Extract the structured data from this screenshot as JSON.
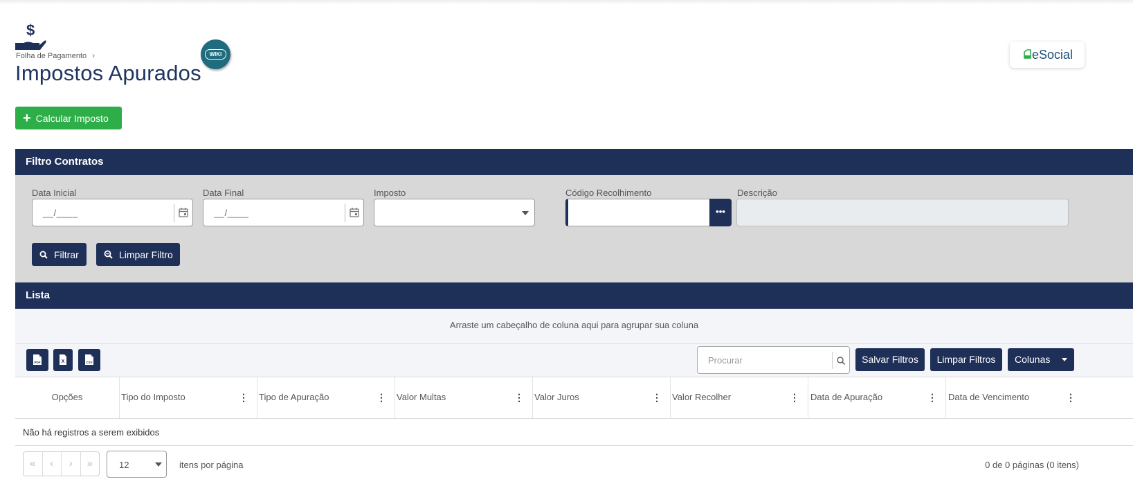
{
  "header": {
    "breadcrumb": "Folha de Pagamento",
    "breadcrumb_sep": "›",
    "title": "Impostos Apurados",
    "wiki_label": "WIKI",
    "esocial_label": "eSocial",
    "page_icon": "money-hand-icon"
  },
  "actions": {
    "calc_label": "Calcular Imposto"
  },
  "filter": {
    "title": "Filtro Contratos",
    "data_inicial_label": "Data Inicial",
    "data_inicial_mask": "__/____",
    "data_final_label": "Data Final",
    "data_final_mask": "__/____",
    "imposto_label": "Imposto",
    "imposto_value": "",
    "codigo_label": "Código Recolhimento",
    "codigo_value": "",
    "codigo_btn": "•••",
    "descricao_label": "Descrição",
    "descricao_value": "",
    "filtrar_label": "Filtrar",
    "limpar_label": "Limpar Filtro"
  },
  "list": {
    "title": "Lista",
    "group_hint": "Arraste um cabeçalho de coluna aqui para agrupar sua coluna",
    "export_icons": [
      "pdf-icon",
      "excel-icon",
      "csv-icon"
    ],
    "search_placeholder": "Procurar",
    "save_filters": "Salvar Filtros",
    "clear_filters": "Limpar Filtros",
    "columns_btn": "Colunas",
    "columns": [
      "Opções",
      "Tipo do Imposto",
      "Tipo de Apuração",
      "Valor Multas",
      "Valor Juros",
      "Valor Recolher",
      "Data de Apuração",
      "Data de Vencimento"
    ],
    "kebab": "⋮",
    "empty": "Não há registros a serem exibidos",
    "pager": [
      "«",
      "‹",
      "›",
      "»"
    ],
    "page_size": "12",
    "per_page_label": "itens por página",
    "page_info": "0 de 0 páginas (0 itens)"
  },
  "colors": {
    "navy": "#1f3058",
    "green": "#2eae48",
    "title": "#1f3560",
    "wiki": "#1e6c7e"
  }
}
